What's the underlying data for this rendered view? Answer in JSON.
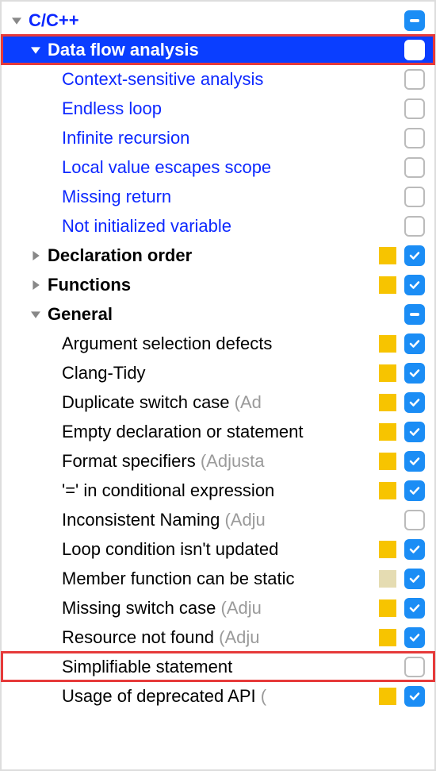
{
  "tree": {
    "root": {
      "label": "C/C++",
      "state": "mixed"
    },
    "dataFlow": {
      "label": "Data flow analysis",
      "children": [
        {
          "label": "Context-sensitive analysis"
        },
        {
          "label": "Endless loop"
        },
        {
          "label": "Infinite recursion"
        },
        {
          "label": "Local value escapes scope"
        },
        {
          "label": "Missing return"
        },
        {
          "label": "Not initialized variable"
        }
      ]
    },
    "declarationOrder": {
      "label": "Declaration order"
    },
    "functions": {
      "label": "Functions"
    },
    "general": {
      "label": "General",
      "children": [
        {
          "label": "Argument selection defects",
          "checked": true,
          "sq": "yellow"
        },
        {
          "label": "Clang-Tidy",
          "checked": true,
          "sq": "yellow"
        },
        {
          "label": "Duplicate switch case ",
          "paren": "(Ad",
          "checked": true,
          "sq": "yellow"
        },
        {
          "label": "Empty declaration or statement",
          "checked": true,
          "sq": "yellow"
        },
        {
          "label": "Format specifiers ",
          "paren": "(Adjusta",
          "checked": true,
          "sq": "yellow"
        },
        {
          "label": "'=' in conditional expression",
          "checked": true,
          "sq": "yellow"
        },
        {
          "label": "Inconsistent Naming ",
          "paren": "(Adju",
          "checked": false,
          "sq": "none"
        },
        {
          "label": "Loop condition isn't updated",
          "checked": true,
          "sq": "yellow"
        },
        {
          "label": "Member function can be static",
          "checked": true,
          "sq": "faded"
        },
        {
          "label": "Missing switch case ",
          "paren": "(Adju",
          "checked": true,
          "sq": "yellow"
        },
        {
          "label": "Resource not found ",
          "paren": "(Adju",
          "checked": true,
          "sq": "yellow"
        },
        {
          "label": "Simplifiable statement",
          "checked": false,
          "sq": "none",
          "highlight": true
        },
        {
          "label": "Usage of deprecated API ",
          "paren": "(",
          "checked": true,
          "sq": "yellow"
        }
      ]
    }
  }
}
